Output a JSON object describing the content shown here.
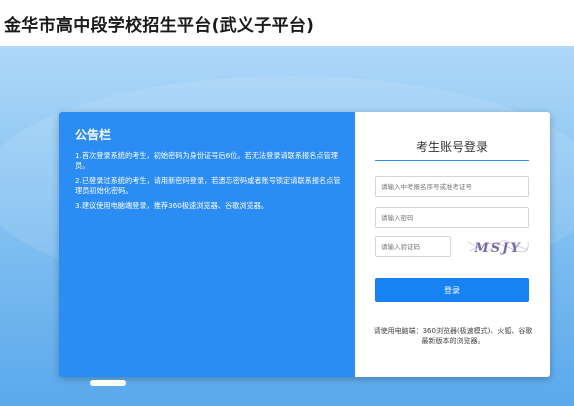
{
  "header": {
    "title": "金华市高中段学校招生平台(武义子平台)"
  },
  "notice": {
    "title": "公告栏",
    "items": [
      "1.首次登录系统的考生，初始密码为身份证号后6位。若无法登录请联系报名点管理员。",
      "2.已登录过系统的考生，请用新密码登录，若遗忘密码或者账号锁定请联系报名点管理员初始化密码。",
      "3.建议使用电脑端登录，推荐360极速浏览器、谷歌浏览器。"
    ]
  },
  "login": {
    "title": "考生账号登录",
    "username_placeholder": "请输入中考报名序号或准考证号",
    "password_placeholder": "请输入密码",
    "captcha_placeholder": "请输入验证码",
    "captcha_text": "MSJY",
    "submit_label": "登录",
    "browser_tip": "请使用电脑端：360浏览器(极速模式)、火狐、谷歌最新版本的浏览器。"
  },
  "colors": {
    "notice_bg": "#2b8cf3",
    "button_bg": "#1782f2",
    "title_underline": "#2b8cf3"
  },
  "carousel": {
    "indicator_icon": "carousel-indicator"
  }
}
